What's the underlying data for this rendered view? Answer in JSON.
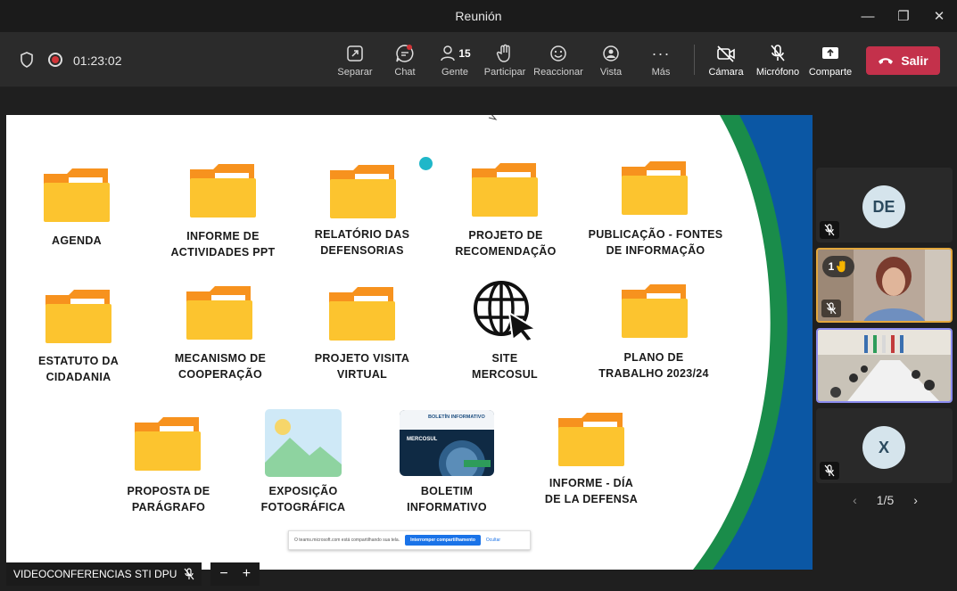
{
  "window": {
    "title": "Reunión",
    "minimize": "—",
    "maximize": "❐",
    "close": "✕"
  },
  "toolbar": {
    "timer": "01:23:02",
    "items": [
      {
        "label": "Separar",
        "icon": "pop-out-icon"
      },
      {
        "label": "Chat",
        "icon": "chat-icon"
      },
      {
        "label": "Gente",
        "icon": "people-icon",
        "count": "15"
      },
      {
        "label": "Participar",
        "icon": "raise-hand-icon"
      },
      {
        "label": "Reaccionar",
        "icon": "smiley-icon"
      },
      {
        "label": "Vista",
        "icon": "view-icon"
      },
      {
        "label": "Más",
        "icon": "more-icon"
      },
      {
        "label": "Cámara",
        "icon": "camera-off-icon"
      },
      {
        "label": "Micrófono",
        "icon": "mic-off-icon"
      },
      {
        "label": "Comparte",
        "icon": "share-icon"
      }
    ],
    "leave_label": "Salir"
  },
  "slide": {
    "items": [
      {
        "label": "AGENDA",
        "icon": "folder-icon"
      },
      {
        "label": "INFORME DE\nACTIVIDADES PPT",
        "icon": "folder-icon"
      },
      {
        "label": "RELATÓRIO DAS\nDEFENSORIAS",
        "icon": "folder-icon"
      },
      {
        "label": "PROJETO DE\nRECOMENDAÇÃO",
        "icon": "folder-icon"
      },
      {
        "label": "PUBLICAÇÃO - FONTES\nDE INFORMAÇÃO",
        "icon": "folder-icon"
      },
      {
        "label": "ESTATUTO DA\nCIDADANIA",
        "icon": "folder-icon"
      },
      {
        "label": "MECANISMO DE\nCOOPERAÇÃO",
        "icon": "folder-icon"
      },
      {
        "label": "PROJETO VISITA\nVIRTUAL",
        "icon": "folder-icon"
      },
      {
        "label": "SITE\nMERCOSUL",
        "icon": "globe-cursor-icon"
      },
      {
        "label": "PLANO DE\nTRABALHO 2023/24",
        "icon": "folder-icon"
      },
      {
        "label": "PROPOSTA DE\nPARÁGRAFO",
        "icon": "folder-icon"
      },
      {
        "label": "EXPOSIÇÃO\nFOTOGRÁFICA",
        "icon": "image-icon"
      },
      {
        "label": "BOLETIM\nINFORMATIVO",
        "icon": "newsletter-thumbnail"
      },
      {
        "label": "INFORME - DÍA\nDE LA DEFENSA",
        "icon": "folder-icon"
      }
    ],
    "newsletter_thumb": {
      "heading": "BOLETÍN INFORMATIVO",
      "brand": "MERCOSUL"
    },
    "share_bar": {
      "message": "O teams.microsoft.com está compartilhando sua tela.",
      "stop_label": "Interromper compartilhamento",
      "hide_label": "Ocultar"
    }
  },
  "presenter": {
    "name": "VIDEOCONFERENCIAS STI DPU",
    "zoom_out": "−",
    "zoom_in": "+"
  },
  "participants": [
    {
      "initials": "DE",
      "type": "avatar"
    },
    {
      "initials": "",
      "type": "video",
      "hand_raised": "1"
    },
    {
      "initials": "",
      "type": "video-room"
    },
    {
      "initials": "X",
      "type": "avatar"
    }
  ],
  "pager": {
    "text": "1/5",
    "prev": "‹",
    "next": "›"
  },
  "colors": {
    "accent_red": "#c4314b",
    "folder": "#fcc42f",
    "folder_tab": "#f7921e",
    "slide_green": "#1a8c4a",
    "slide_blue": "#0b57a4",
    "hand": "#f7b500",
    "active_tile": "#e3a73c",
    "pinned_tile": "#8b8cf0"
  }
}
